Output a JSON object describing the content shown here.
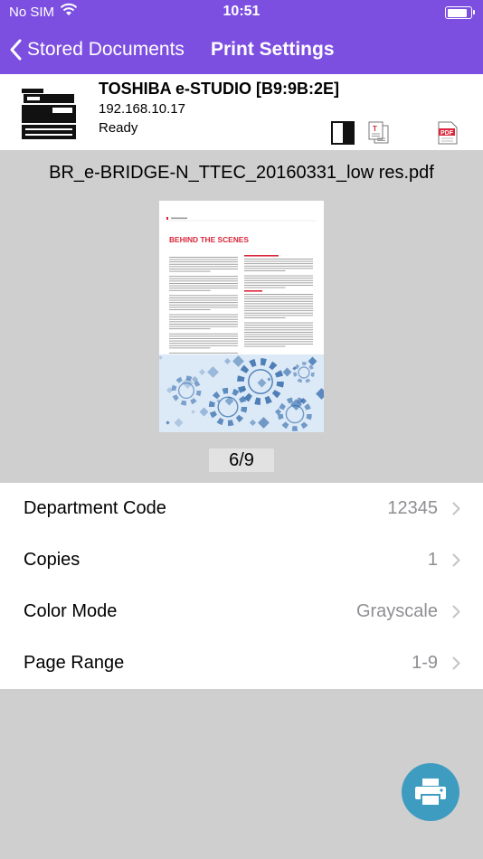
{
  "status_bar": {
    "carrier": "No SIM",
    "time": "10:51",
    "battery_level": 0.9
  },
  "nav": {
    "back_label": "Stored Documents",
    "title": "Print Settings"
  },
  "printer": {
    "name": "TOSHIBA e-STUDIO [B9:9B:2E]",
    "ip": "192.168.10.17",
    "status": "Ready"
  },
  "document": {
    "file_name": "BR_e-BRIDGE-N_TTEC_20160331_low res.pdf",
    "page_counter": "6/9",
    "thumb": {
      "heading": "BEHIND THE SCENES",
      "accent_color": "#d9263a",
      "graphic_color": "#2a64a8"
    }
  },
  "settings": [
    {
      "label": "Department Code",
      "value": "12345"
    },
    {
      "label": "Copies",
      "value": "1"
    },
    {
      "label": "Color Mode",
      "value": "Grayscale"
    },
    {
      "label": "Page Range",
      "value": "1-9"
    }
  ],
  "colors": {
    "brand": "#7c4fe0",
    "fab": "#3e9cc0"
  },
  "icons": {
    "back": "chevron-left-icon",
    "printer": "mfp-printer-icon",
    "fab": "printer-icon"
  }
}
